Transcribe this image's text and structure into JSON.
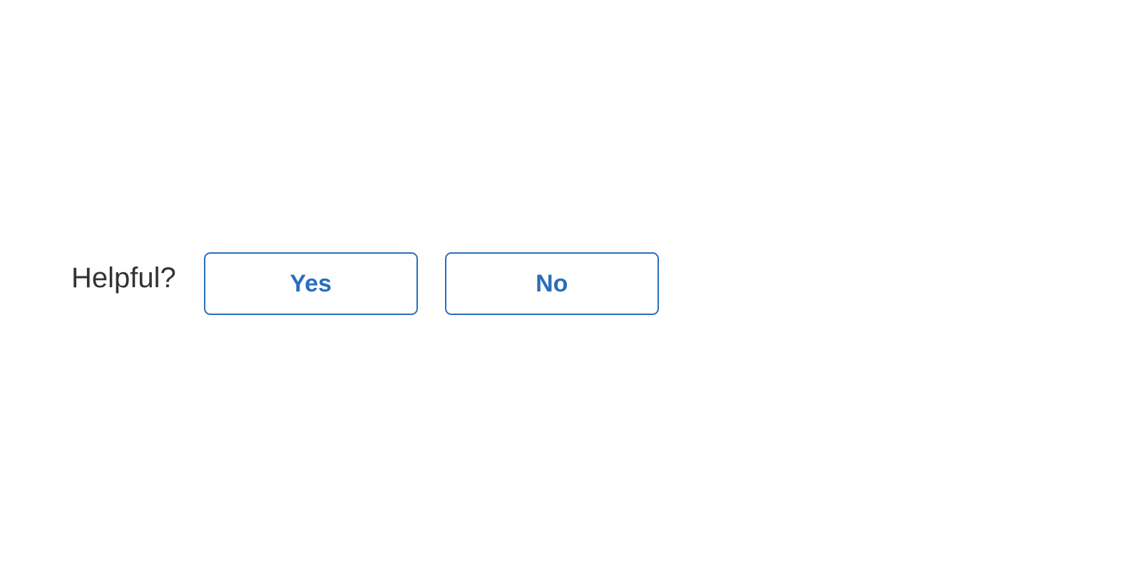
{
  "feedback": {
    "label": "Helpful?",
    "yes_label": "Yes",
    "no_label": "No",
    "accent_color": "#2a6ebb",
    "label_color": "#333333"
  }
}
